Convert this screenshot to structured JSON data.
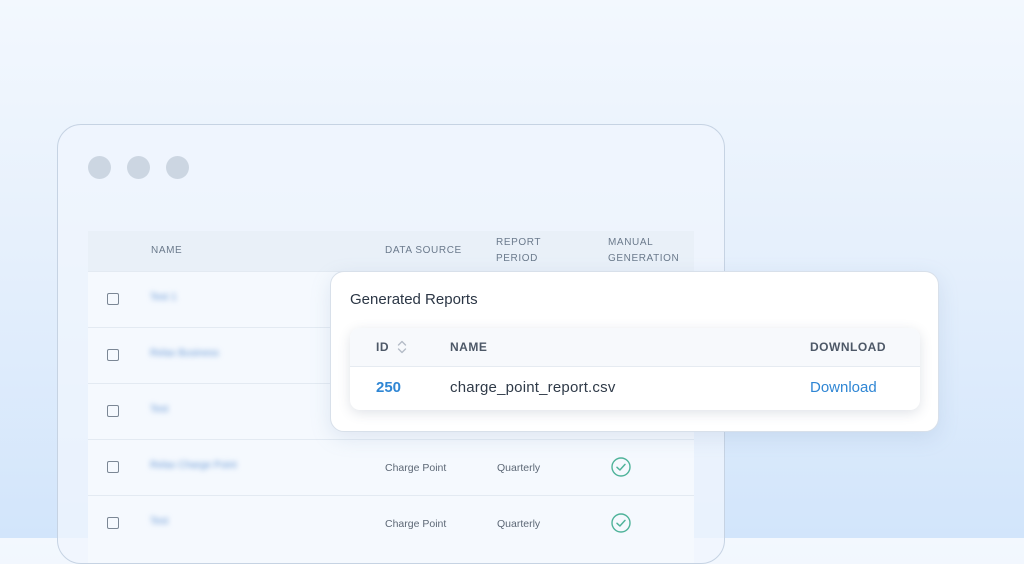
{
  "background_table": {
    "headers": {
      "name": "NAME",
      "data_source": "DATA SOURCE",
      "report_period": "REPORT PERIOD",
      "manual_generation": "MANUAL GENERATION"
    },
    "rows": [
      {
        "name": "Test 1",
        "data_source": "",
        "report_period": "",
        "manual": false
      },
      {
        "name": "Relax Business",
        "data_source": "",
        "report_period": "",
        "manual": false
      },
      {
        "name": "Test",
        "data_source": "",
        "report_period": "",
        "manual": false
      },
      {
        "name": "Relax Charge Point",
        "data_source": "Charge Point",
        "report_period": "Quarterly",
        "manual": true
      },
      {
        "name": "Test",
        "data_source": "Charge Point",
        "report_period": "Quarterly",
        "manual": true
      }
    ]
  },
  "popup": {
    "title": "Generated Reports",
    "headers": {
      "id": "ID",
      "name": "NAME",
      "download": "DOWNLOAD"
    },
    "rows": [
      {
        "id": "250",
        "name": "charge_point_report.csv",
        "download": "Download"
      }
    ]
  },
  "colors": {
    "accent": "#2f86d4",
    "check": "#4fb39a",
    "window_dot": "#ccd6e2"
  },
  "icons": {
    "sort": "sort-updown-icon",
    "check": "check-circle-icon"
  }
}
